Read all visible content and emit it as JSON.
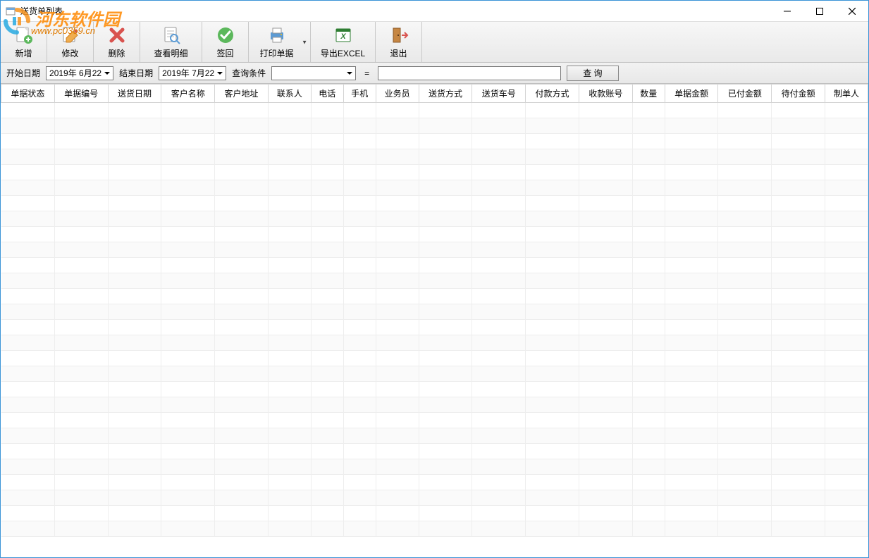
{
  "window": {
    "title": "送货单列表"
  },
  "watermark": {
    "text": "河东软件园",
    "url": "www.pc0359.cn"
  },
  "toolbar": {
    "new_label": "新增",
    "edit_label": "修改",
    "delete_label": "删除",
    "detail_label": "查看明细",
    "signback_label": "签回",
    "print_label": "打印单据",
    "export_label": "导出EXCEL",
    "exit_label": "退出"
  },
  "filter": {
    "start_label": "开始日期",
    "start_value": "2019年 6月22",
    "end_label": "结束日期",
    "end_value": "2019年 7月22",
    "condition_label": "查询条件",
    "condition_value": "",
    "query_value": "",
    "query_btn": "查 询",
    "equals": "="
  },
  "columns": [
    "单据状态",
    "单据编号",
    "送货日期",
    "客户名称",
    "客户地址",
    "联系人",
    "电话",
    "手机",
    "业务员",
    "送货方式",
    "送货车号",
    "付款方式",
    "收款账号",
    "数量",
    "单据金额",
    "已付金额",
    "待付金额",
    "制单人"
  ],
  "rows": []
}
